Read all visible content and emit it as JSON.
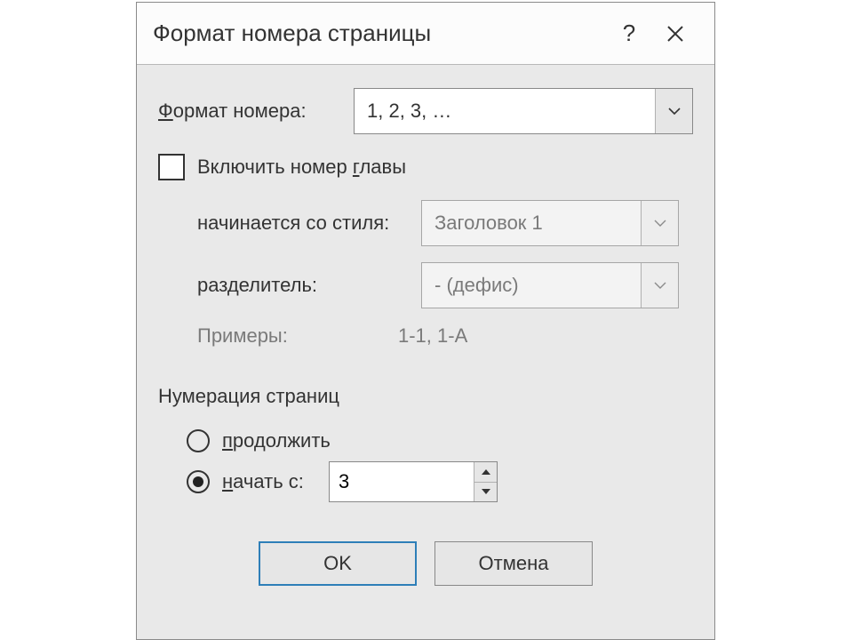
{
  "title": "Формат номера страницы",
  "help_symbol": "?",
  "close_label": "✕",
  "format_label_pre": "",
  "format_label_u": "Ф",
  "format_label_post": "ормат номера:",
  "format_value": "1, 2, 3, …",
  "include_chapter_pre": "Включить номер ",
  "include_chapter_u": "г",
  "include_chapter_post": "лавы",
  "starts_with_style_label": "начинается со стиля:",
  "starts_with_style_value": "Заголовок 1",
  "separator_label": "разделитель:",
  "separator_value": "-    (дефис)",
  "examples_label": "Примеры:",
  "examples_value": "1-1, 1-A",
  "numbering_group": "Нумерация страниц",
  "continue_pre": "",
  "continue_u": "п",
  "continue_post": "родолжить",
  "start_from_pre": "",
  "start_from_u": "н",
  "start_from_post": "ачать с:",
  "start_value": "3",
  "ok_label": "OK",
  "cancel_label": "Отмена"
}
